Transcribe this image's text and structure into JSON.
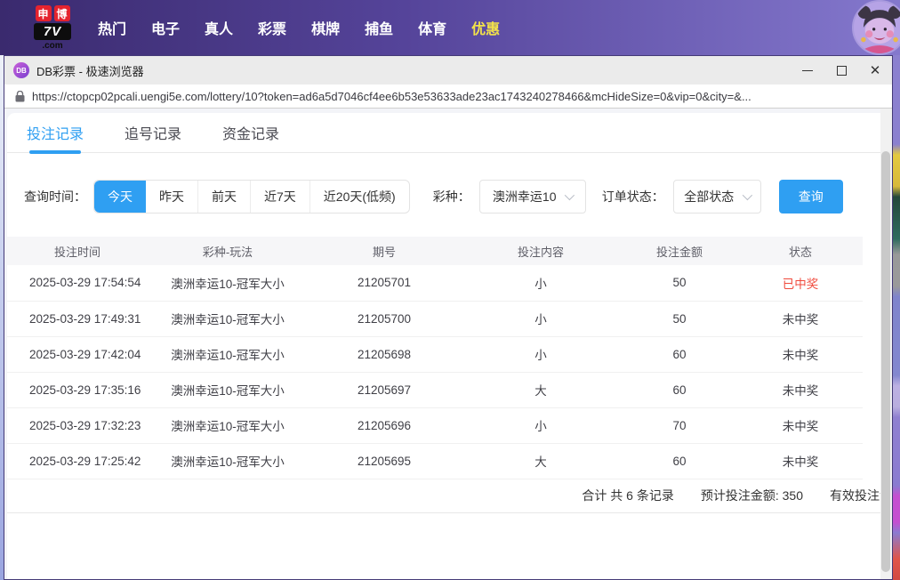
{
  "site_header": {
    "logo": {
      "sq1": "申",
      "sq2": "博",
      "mid": "7V",
      "bottom": ".com"
    },
    "nav_items": [
      {
        "label": "热门"
      },
      {
        "label": "电子"
      },
      {
        "label": "真人"
      },
      {
        "label": "彩票"
      },
      {
        "label": "棋牌"
      },
      {
        "label": "捕鱼"
      },
      {
        "label": "体育"
      },
      {
        "label": "优惠"
      }
    ]
  },
  "browser": {
    "favicon_text": "DB",
    "window_title": "DB彩票 - 极速浏览器",
    "url": "https://ctopcp02pcali.uengi5e.com/lottery/10?token=ad6a5d7046cf4ee6b53e53633ade23ac1743240278466&mcHideSize=0&vip=0&city=&...",
    "icons": {
      "close": "✕"
    }
  },
  "page": {
    "tabs": [
      {
        "label": "投注记录",
        "active": true
      },
      {
        "label": "追号记录",
        "active": false
      },
      {
        "label": "资金记录",
        "active": false
      }
    ],
    "filters": {
      "time_label": "查询时间：",
      "time_options": [
        {
          "label": "今天",
          "active": true
        },
        {
          "label": "昨天",
          "active": false
        },
        {
          "label": "前天",
          "active": false
        },
        {
          "label": "近7天",
          "active": false
        },
        {
          "label": "近20天(低频)",
          "active": false
        }
      ],
      "lottery_label": "彩种：",
      "lottery_value": "澳洲幸运10",
      "status_label": "订单状态：",
      "status_value": "全部状态",
      "query_button": "查询"
    },
    "table": {
      "columns": [
        "投注时间",
        "彩种-玩法",
        "期号",
        "投注内容",
        "投注金额",
        "状态"
      ],
      "rows": [
        {
          "time": "2025-03-29 17:54:54",
          "game": "澳洲幸运10-冠军大小",
          "issue": "21205701",
          "content": "小",
          "amount": "50",
          "status": "已中奖",
          "won": true
        },
        {
          "time": "2025-03-29 17:49:31",
          "game": "澳洲幸运10-冠军大小",
          "issue": "21205700",
          "content": "小",
          "amount": "50",
          "status": "未中奖",
          "won": false
        },
        {
          "time": "2025-03-29 17:42:04",
          "game": "澳洲幸运10-冠军大小",
          "issue": "21205698",
          "content": "小",
          "amount": "60",
          "status": "未中奖",
          "won": false
        },
        {
          "time": "2025-03-29 17:35:16",
          "game": "澳洲幸运10-冠军大小",
          "issue": "21205697",
          "content": "大",
          "amount": "60",
          "status": "未中奖",
          "won": false
        },
        {
          "time": "2025-03-29 17:32:23",
          "game": "澳洲幸运10-冠军大小",
          "issue": "21205696",
          "content": "小",
          "amount": "70",
          "status": "未中奖",
          "won": false
        },
        {
          "time": "2025-03-29 17:25:42",
          "game": "澳洲幸运10-冠军大小",
          "issue": "21205695",
          "content": "大",
          "amount": "60",
          "status": "未中奖",
          "won": false
        }
      ]
    },
    "summary": {
      "total": "合计 共 6 条记录",
      "expected": "预计投注金额: 350",
      "valid": "有效投注金"
    }
  },
  "colors": {
    "accent_blue": "#2f9ff2",
    "win_red": "#f04a3c",
    "promo_yellow": "#f3e24a",
    "header_gradient_start": "#3a2a6e",
    "header_gradient_end": "#8478cd"
  }
}
